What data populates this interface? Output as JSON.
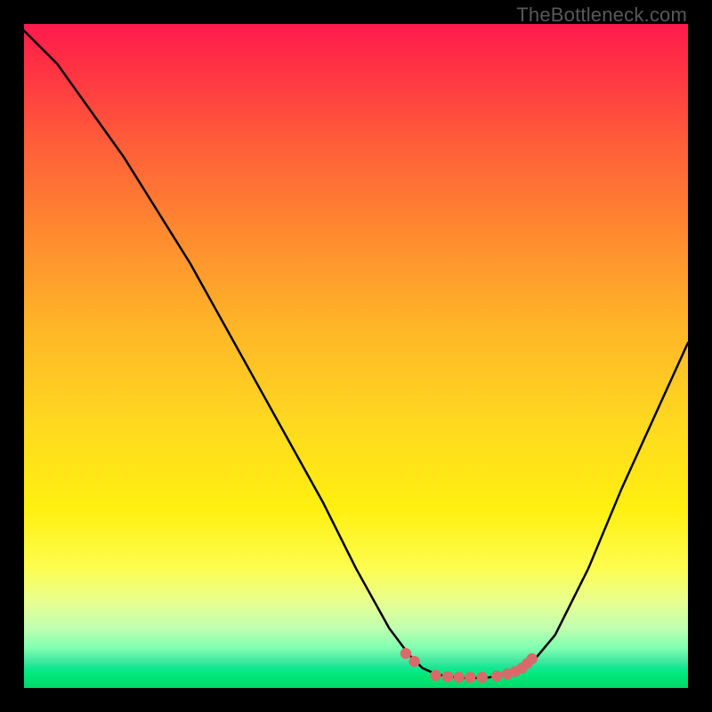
{
  "watermark": "TheBottleneck.com",
  "colors": {
    "background": "#000000",
    "curve_line": "#000000",
    "dot_fill": "#d86a6a",
    "gradient_top": "#ff1a4d",
    "gradient_bottom": "#00d868"
  },
  "chart_data": {
    "type": "line",
    "title": "",
    "xlabel": "",
    "ylabel": "",
    "xlim": [
      0,
      100
    ],
    "ylim": [
      0,
      100
    ],
    "series": [
      {
        "name": "curve",
        "x": [
          0,
          5,
          10,
          15,
          20,
          25,
          30,
          35,
          40,
          45,
          50,
          55,
          58,
          60,
          62,
          64,
          66,
          68,
          70,
          72,
          74,
          76,
          80,
          85,
          90,
          95,
          100
        ],
        "values": [
          99,
          94,
          87,
          80,
          72,
          64,
          55,
          46,
          37,
          28,
          18,
          9,
          5,
          3,
          2.1,
          1.7,
          1.5,
          1.5,
          1.6,
          1.9,
          2.4,
          3.2,
          8,
          18,
          30,
          41,
          52
        ]
      }
    ],
    "markers": {
      "name": "highlight-dots",
      "x": [
        57.5,
        58.8,
        62.0,
        63.8,
        65.5,
        67.2,
        69.0,
        71.2,
        72.8,
        74.0,
        75.0,
        75.8,
        76.5
      ],
      "values": [
        5.2,
        4.0,
        1.9,
        1.7,
        1.6,
        1.6,
        1.6,
        1.8,
        2.1,
        2.5,
        3.0,
        3.7,
        4.4
      ]
    }
  }
}
